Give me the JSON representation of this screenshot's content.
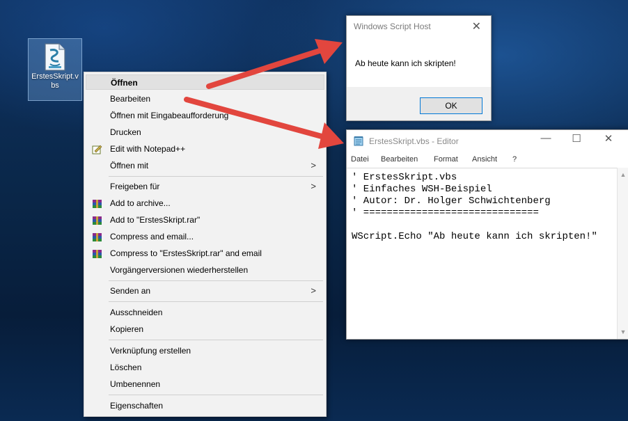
{
  "desktop": {
    "icon_label": "ErstesSkript.vbs"
  },
  "context_menu": {
    "items": [
      {
        "label": "Öffnen",
        "icon": "",
        "submenu": false
      },
      {
        "label": "Bearbeiten",
        "icon": "",
        "submenu": false
      },
      {
        "label": "Öffnen mit Eingabeaufforderung",
        "icon": "",
        "submenu": false
      },
      {
        "label": "Drucken",
        "icon": "",
        "submenu": false
      },
      {
        "label": "Edit with Notepad++",
        "icon": "notepad-plus-plus-icon",
        "submenu": false
      },
      {
        "label": "Öffnen mit",
        "icon": "",
        "submenu": true
      },
      {
        "label": "Freigeben für",
        "icon": "",
        "submenu": true
      },
      {
        "label": "Add to archive...",
        "icon": "winrar-icon",
        "submenu": false
      },
      {
        "label": "Add to \"ErstesSkript.rar\"",
        "icon": "winrar-icon",
        "submenu": false
      },
      {
        "label": "Compress and email...",
        "icon": "winrar-icon",
        "submenu": false
      },
      {
        "label": "Compress to \"ErstesSkript.rar\" and email",
        "icon": "winrar-icon",
        "submenu": false
      },
      {
        "label": "Vorgängerversionen wiederherstellen",
        "icon": "",
        "submenu": false
      },
      {
        "label": "Senden an",
        "icon": "",
        "submenu": true
      },
      {
        "label": "Ausschneiden",
        "icon": "",
        "submenu": false
      },
      {
        "label": "Kopieren",
        "icon": "",
        "submenu": false
      },
      {
        "label": "Verknüpfung erstellen",
        "icon": "",
        "submenu": false
      },
      {
        "label": "Löschen",
        "icon": "",
        "submenu": false
      },
      {
        "label": "Umbenennen",
        "icon": "",
        "submenu": false
      },
      {
        "label": "Eigenschaften",
        "icon": "",
        "submenu": false
      }
    ],
    "submenu_arrow": ">"
  },
  "msgbox": {
    "title": "Windows Script Host",
    "close": "✕",
    "text": "Ab heute kann ich skripten!",
    "ok_label": "OK"
  },
  "notepad": {
    "title": "ErstesSkript.vbs - Editor",
    "minimize": "—",
    "maximize": "☐",
    "close": "✕",
    "menu": [
      "Datei",
      "Bearbeiten",
      "Format",
      "Ansicht",
      "?"
    ],
    "content": "' ErstesSkript.vbs\n' Einfaches WSH-Beispiel\n' Autor: Dr. Holger Schwichtenberg\n' ==============================\n\nWScript.Echo \"Ab heute kann ich skripten!\""
  },
  "colors": {
    "arrow": "#e2463e",
    "winrar_icon": "#7a2a7a",
    "ok_border": "#0078d7"
  }
}
